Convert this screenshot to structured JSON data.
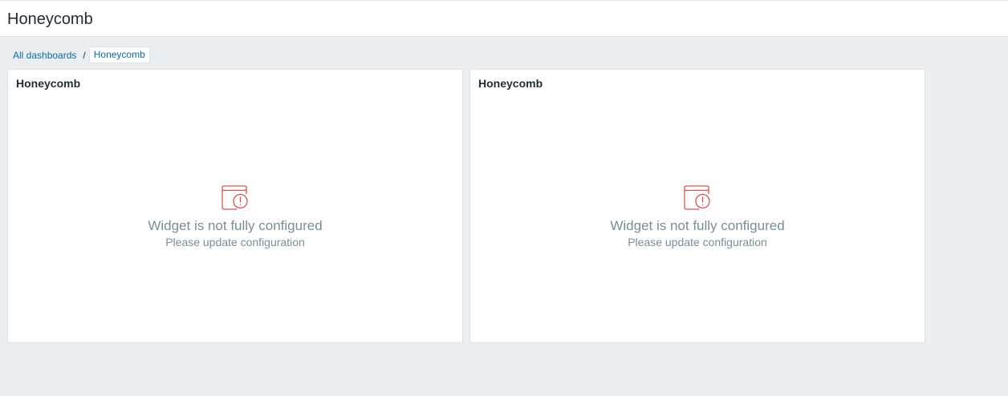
{
  "header": {
    "title": "Honeycomb"
  },
  "breadcrumb": {
    "items": [
      {
        "label": "All dashboards"
      },
      {
        "label": "Honeycomb"
      }
    ],
    "separator": "/"
  },
  "widgets": [
    {
      "title": "Honeycomb",
      "icon": "widget-warning-icon",
      "message": "Widget is not fully configured",
      "submessage": "Please update configuration"
    },
    {
      "title": "Honeycomb",
      "icon": "widget-warning-icon",
      "message": "Widget is not fully configured",
      "submessage": "Please update configuration"
    }
  ],
  "colors": {
    "background": "#ebeef0",
    "link": "#0a6ba8",
    "warning": "#d9534f",
    "muted_text": "#768d99"
  }
}
